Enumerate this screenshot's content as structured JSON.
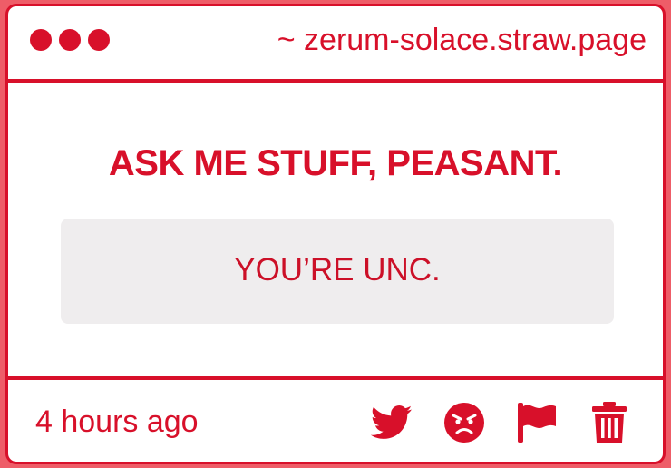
{
  "window": {
    "url": "~ zerum-solace.straw.page"
  },
  "main": {
    "heading": "ASK ME STUFF, PEASANT.",
    "answer": "YOU’RE UNC."
  },
  "footer": {
    "timestamp": "4 hours ago",
    "icons": [
      "twitter-icon",
      "angry-face-icon",
      "flag-icon",
      "trash-icon"
    ]
  },
  "colors": {
    "accent": "#d8102a",
    "page_background": "#ee5d68",
    "card_background": "#ffffff",
    "answer_box": "#efedee"
  }
}
